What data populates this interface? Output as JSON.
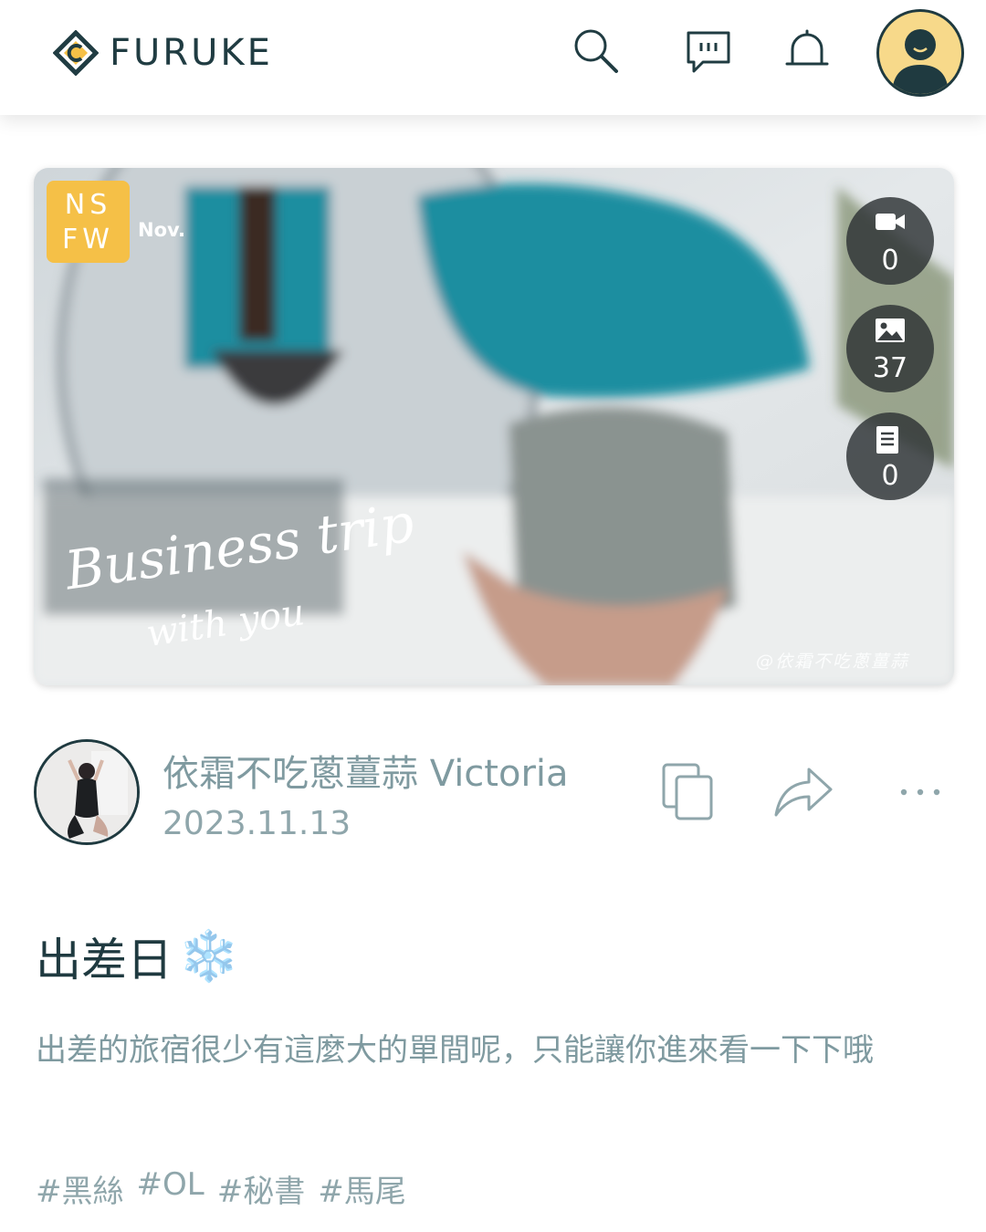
{
  "header": {
    "brand": "FURUKE",
    "icons": [
      "search-icon",
      "chat-icon",
      "bell-icon",
      "user-avatar"
    ]
  },
  "cover": {
    "badge_line1": "NS",
    "badge_line2": "FW",
    "month_label": "Nov.",
    "script_title": "Business trip",
    "script_subtitle": "with you",
    "watermark": "@依霜不吃蔥薑蒜",
    "stats": [
      {
        "icon": "video-icon",
        "value": "0"
      },
      {
        "icon": "image-icon",
        "value": "37"
      },
      {
        "icon": "article-icon",
        "value": "0"
      }
    ]
  },
  "author": {
    "name": "依霜不吃蔥薑蒜 Victoria",
    "date": "2023.11.13"
  },
  "post": {
    "title": "出差日",
    "title_emoji": "❄️",
    "description": "出差的旅宿很少有這麼大的單間呢，只能讓你進來看一下下哦",
    "tags": [
      "#黑絲",
      "#OL",
      "#秘書",
      "#馬尾"
    ]
  },
  "colors": {
    "primary": "#1f3a40",
    "muted": "#7f9aa0",
    "badge": "#f5c047",
    "avatar_bg": "#f7d98a"
  }
}
